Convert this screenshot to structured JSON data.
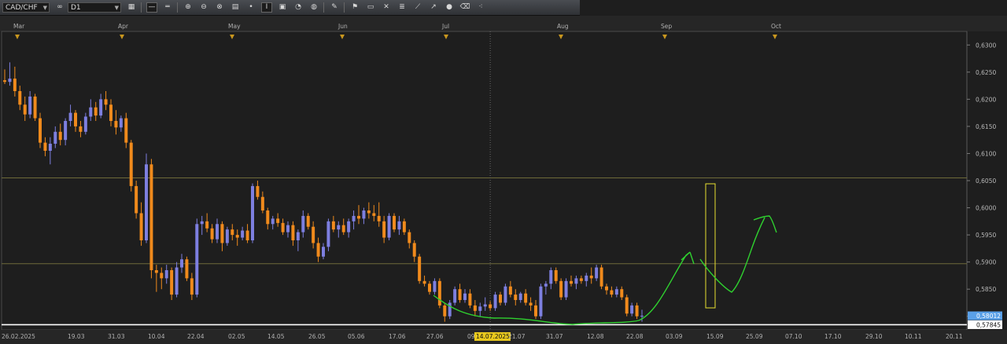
{
  "toolbar": {
    "symbol": "CAD/CHF",
    "timeframe": "D1",
    "buttons": [
      "link-icon",
      "chart-type-icon",
      "line-icon",
      "crosshair-line-icon",
      "zoom-in-icon",
      "zoom-out-icon",
      "zoom-fit-icon",
      "grid-icon",
      "point-icon",
      "text-marker-icon",
      "layout-icon",
      "paint-icon",
      "globe-icon",
      "pencil-icon",
      "indicator-icon",
      "window-icon",
      "fibonacci-icon",
      "channel-icon",
      "trend-tool-icon",
      "arrow-tool-icon",
      "ellipse-icon",
      "eraser-icon",
      "more-icon"
    ]
  },
  "chart_data": {
    "type": "candlestick",
    "symbol": "CAD/CHF",
    "timeframe": "D1",
    "months": [
      "Mar",
      "Apr",
      "May",
      "Jun",
      "Jul",
      "Aug",
      "Sep",
      "Oct"
    ],
    "x_labels": [
      "26.02.2025",
      "19.03",
      "31.03",
      "10.04",
      "22.04",
      "02.05",
      "14.05",
      "26.05",
      "05.06",
      "17.06",
      "27.06",
      "09",
      "14.07.2025",
      "21.07",
      "31.07",
      "12.08",
      "22.08",
      "03.09",
      "15.09",
      "25.09",
      "07.10",
      "17.10",
      "29.10",
      "10.11",
      "20.11"
    ],
    "crosshair_label": "14.07.2025",
    "y_ticks": [
      "0,6300",
      "0,6250",
      "0,6200",
      "0,6150",
      "0,6100",
      "0,6050",
      "0,6000",
      "0,5950",
      "0,5900",
      "0,5850",
      "0,5800"
    ],
    "ylim": [
      0.5775,
      0.6325
    ],
    "horizontal_levels": [
      0.6055,
      0.5897,
      0.57845
    ],
    "price_labels": [
      {
        "text": "0,58012",
        "value": 0.5801,
        "color": "#5aa0e8"
      },
      {
        "text": "0,57845",
        "value": 0.57845,
        "color": "#ffffff"
      }
    ],
    "bull_color": "#7d7fe0",
    "bear_color": "#f08a1c",
    "candles": [
      [
        0.6235,
        0.6255,
        0.6228,
        0.6232
      ],
      [
        0.6232,
        0.6268,
        0.6225,
        0.6238
      ],
      [
        0.6238,
        0.626,
        0.6205,
        0.6215
      ],
      [
        0.6215,
        0.6225,
        0.618,
        0.619
      ],
      [
        0.619,
        0.6205,
        0.616,
        0.6172
      ],
      [
        0.6172,
        0.6215,
        0.6165,
        0.6205
      ],
      [
        0.6205,
        0.621,
        0.616,
        0.6165
      ],
      [
        0.6165,
        0.6175,
        0.611,
        0.612
      ],
      [
        0.612,
        0.613,
        0.6095,
        0.6105
      ],
      [
        0.6105,
        0.613,
        0.608,
        0.6118
      ],
      [
        0.6118,
        0.615,
        0.611,
        0.614
      ],
      [
        0.614,
        0.6155,
        0.6115,
        0.6125
      ],
      [
        0.6125,
        0.6165,
        0.6115,
        0.616
      ],
      [
        0.616,
        0.619,
        0.615,
        0.6175
      ],
      [
        0.6175,
        0.618,
        0.614,
        0.615
      ],
      [
        0.615,
        0.616,
        0.613,
        0.614
      ],
      [
        0.614,
        0.6175,
        0.6135,
        0.6168
      ],
      [
        0.6168,
        0.62,
        0.616,
        0.6185
      ],
      [
        0.6185,
        0.6195,
        0.616,
        0.617
      ],
      [
        0.617,
        0.621,
        0.6165,
        0.62
      ],
      [
        0.62,
        0.6215,
        0.618,
        0.619
      ],
      [
        0.619,
        0.62,
        0.615,
        0.616
      ],
      [
        0.616,
        0.618,
        0.6135,
        0.6148
      ],
      [
        0.6148,
        0.617,
        0.614,
        0.6165
      ],
      [
        0.6165,
        0.6175,
        0.611,
        0.612
      ],
      [
        0.612,
        0.6125,
        0.603,
        0.604
      ],
      [
        0.604,
        0.605,
        0.598,
        0.599
      ],
      [
        0.599,
        0.601,
        0.593,
        0.594
      ],
      [
        0.594,
        0.61,
        0.5935,
        0.608
      ],
      [
        0.608,
        0.609,
        0.587,
        0.5885
      ],
      [
        0.5885,
        0.5895,
        0.5845,
        0.588
      ],
      [
        0.588,
        0.589,
        0.585,
        0.587
      ],
      [
        0.587,
        0.5895,
        0.586,
        0.5885
      ],
      [
        0.5885,
        0.589,
        0.583,
        0.584
      ],
      [
        0.584,
        0.59,
        0.5835,
        0.589
      ],
      [
        0.589,
        0.5915,
        0.588,
        0.5905
      ],
      [
        0.5905,
        0.591,
        0.5865,
        0.587
      ],
      [
        0.587,
        0.588,
        0.583,
        0.584
      ],
      [
        0.584,
        0.598,
        0.5835,
        0.597
      ],
      [
        0.597,
        0.5985,
        0.595,
        0.5975
      ],
      [
        0.5975,
        0.599,
        0.5955,
        0.5962
      ],
      [
        0.5962,
        0.597,
        0.5935,
        0.5942
      ],
      [
        0.5942,
        0.598,
        0.5935,
        0.597
      ],
      [
        0.597,
        0.5975,
        0.592,
        0.5935
      ],
      [
        0.5935,
        0.5965,
        0.593,
        0.596
      ],
      [
        0.596,
        0.597,
        0.594,
        0.595
      ],
      [
        0.595,
        0.596,
        0.593,
        0.5945
      ],
      [
        0.5945,
        0.5965,
        0.594,
        0.5958
      ],
      [
        0.5958,
        0.597,
        0.5935,
        0.594
      ],
      [
        0.594,
        0.6045,
        0.5935,
        0.604
      ],
      [
        0.604,
        0.605,
        0.6015,
        0.602
      ],
      [
        0.602,
        0.603,
        0.599,
        0.5995
      ],
      [
        0.5995,
        0.6,
        0.596,
        0.597
      ],
      [
        0.597,
        0.5985,
        0.596,
        0.598
      ],
      [
        0.598,
        0.599,
        0.5965,
        0.5972
      ],
      [
        0.5972,
        0.598,
        0.595,
        0.5955
      ],
      [
        0.5955,
        0.5975,
        0.5945,
        0.5968
      ],
      [
        0.5968,
        0.5975,
        0.593,
        0.594
      ],
      [
        0.594,
        0.596,
        0.592,
        0.5955
      ],
      [
        0.5955,
        0.5995,
        0.5945,
        0.5985
      ],
      [
        0.5985,
        0.599,
        0.596,
        0.5965
      ],
      [
        0.5965,
        0.5975,
        0.5925,
        0.5935
      ],
      [
        0.5935,
        0.5945,
        0.59,
        0.591
      ],
      [
        0.591,
        0.5935,
        0.5905,
        0.5928
      ],
      [
        0.5928,
        0.598,
        0.592,
        0.5975
      ],
      [
        0.5975,
        0.5985,
        0.5955,
        0.596
      ],
      [
        0.596,
        0.5975,
        0.5945,
        0.5968
      ],
      [
        0.5968,
        0.598,
        0.595,
        0.5955
      ],
      [
        0.5955,
        0.598,
        0.5945,
        0.5975
      ],
      [
        0.5975,
        0.5995,
        0.596,
        0.5985
      ],
      [
        0.5985,
        0.6005,
        0.597,
        0.598
      ],
      [
        0.598,
        0.6,
        0.597,
        0.5995
      ],
      [
        0.5995,
        0.601,
        0.598,
        0.599
      ],
      [
        0.599,
        0.6005,
        0.5975,
        0.5985
      ],
      [
        0.5985,
        0.601,
        0.5965,
        0.5975
      ],
      [
        0.5975,
        0.5985,
        0.5935,
        0.5945
      ],
      [
        0.5945,
        0.599,
        0.594,
        0.5985
      ],
      [
        0.5985,
        0.599,
        0.5955,
        0.596
      ],
      [
        0.596,
        0.5985,
        0.595,
        0.5975
      ],
      [
        0.5975,
        0.598,
        0.595,
        0.5955
      ],
      [
        0.5955,
        0.596,
        0.5925,
        0.5935
      ],
      [
        0.5935,
        0.594,
        0.59,
        0.591
      ],
      [
        0.591,
        0.5915,
        0.586,
        0.5865
      ],
      [
        0.5865,
        0.5875,
        0.5855,
        0.586
      ],
      [
        0.586,
        0.5865,
        0.584,
        0.5845
      ],
      [
        0.5845,
        0.587,
        0.584,
        0.5865
      ],
      [
        0.5865,
        0.587,
        0.5815,
        0.582
      ],
      [
        0.582,
        0.5825,
        0.579,
        0.58
      ],
      [
        0.58,
        0.583,
        0.5795,
        0.5825
      ],
      [
        0.5825,
        0.5855,
        0.582,
        0.585
      ],
      [
        0.585,
        0.586,
        0.5825,
        0.583
      ],
      [
        0.583,
        0.585,
        0.5825,
        0.5842
      ],
      [
        0.5842,
        0.585,
        0.5815,
        0.582
      ],
      [
        0.582,
        0.583,
        0.58,
        0.581
      ],
      [
        0.581,
        0.5825,
        0.58,
        0.5818
      ],
      [
        0.5818,
        0.5835,
        0.581,
        0.5822
      ],
      [
        0.5822,
        0.5828,
        0.581,
        0.5815
      ],
      [
        0.5815,
        0.5845,
        0.581,
        0.584
      ],
      [
        0.584,
        0.5845,
        0.582,
        0.5825
      ],
      [
        0.5825,
        0.586,
        0.582,
        0.5855
      ],
      [
        0.5855,
        0.5865,
        0.5835,
        0.584
      ],
      [
        0.584,
        0.585,
        0.582,
        0.583
      ],
      [
        0.583,
        0.5845,
        0.5825,
        0.5842
      ],
      [
        0.5842,
        0.585,
        0.582,
        0.5825
      ],
      [
        0.5825,
        0.5835,
        0.581,
        0.582
      ],
      [
        0.582,
        0.583,
        0.5795,
        0.58
      ],
      [
        0.58,
        0.586,
        0.5795,
        0.5855
      ],
      [
        0.5855,
        0.5865,
        0.584,
        0.586
      ],
      [
        0.586,
        0.589,
        0.585,
        0.5885
      ],
      [
        0.5885,
        0.589,
        0.586,
        0.5865
      ],
      [
        0.5865,
        0.587,
        0.583,
        0.5835
      ],
      [
        0.5835,
        0.587,
        0.583,
        0.5865
      ],
      [
        0.5865,
        0.5875,
        0.5855,
        0.586
      ],
      [
        0.586,
        0.5875,
        0.585,
        0.587
      ],
      [
        0.587,
        0.5875,
        0.586,
        0.5865
      ],
      [
        0.5865,
        0.588,
        0.5855,
        0.5875
      ],
      [
        0.5875,
        0.589,
        0.586,
        0.587
      ],
      [
        0.587,
        0.5895,
        0.5865,
        0.589
      ],
      [
        0.589,
        0.5895,
        0.585,
        0.5855
      ],
      [
        0.5855,
        0.586,
        0.584,
        0.5848
      ],
      [
        0.5848,
        0.5855,
        0.5835,
        0.584
      ],
      [
        0.584,
        0.5855,
        0.5835,
        0.585
      ],
      [
        0.585,
        0.5855,
        0.583,
        0.5835
      ],
      [
        0.5835,
        0.584,
        0.58,
        0.5805
      ],
      [
        0.5805,
        0.5825,
        0.58,
        0.582
      ],
      [
        0.582,
        0.5825,
        0.5795,
        0.58
      ],
      [
        0.58,
        0.5812,
        0.579,
        0.5801
      ]
    ]
  }
}
